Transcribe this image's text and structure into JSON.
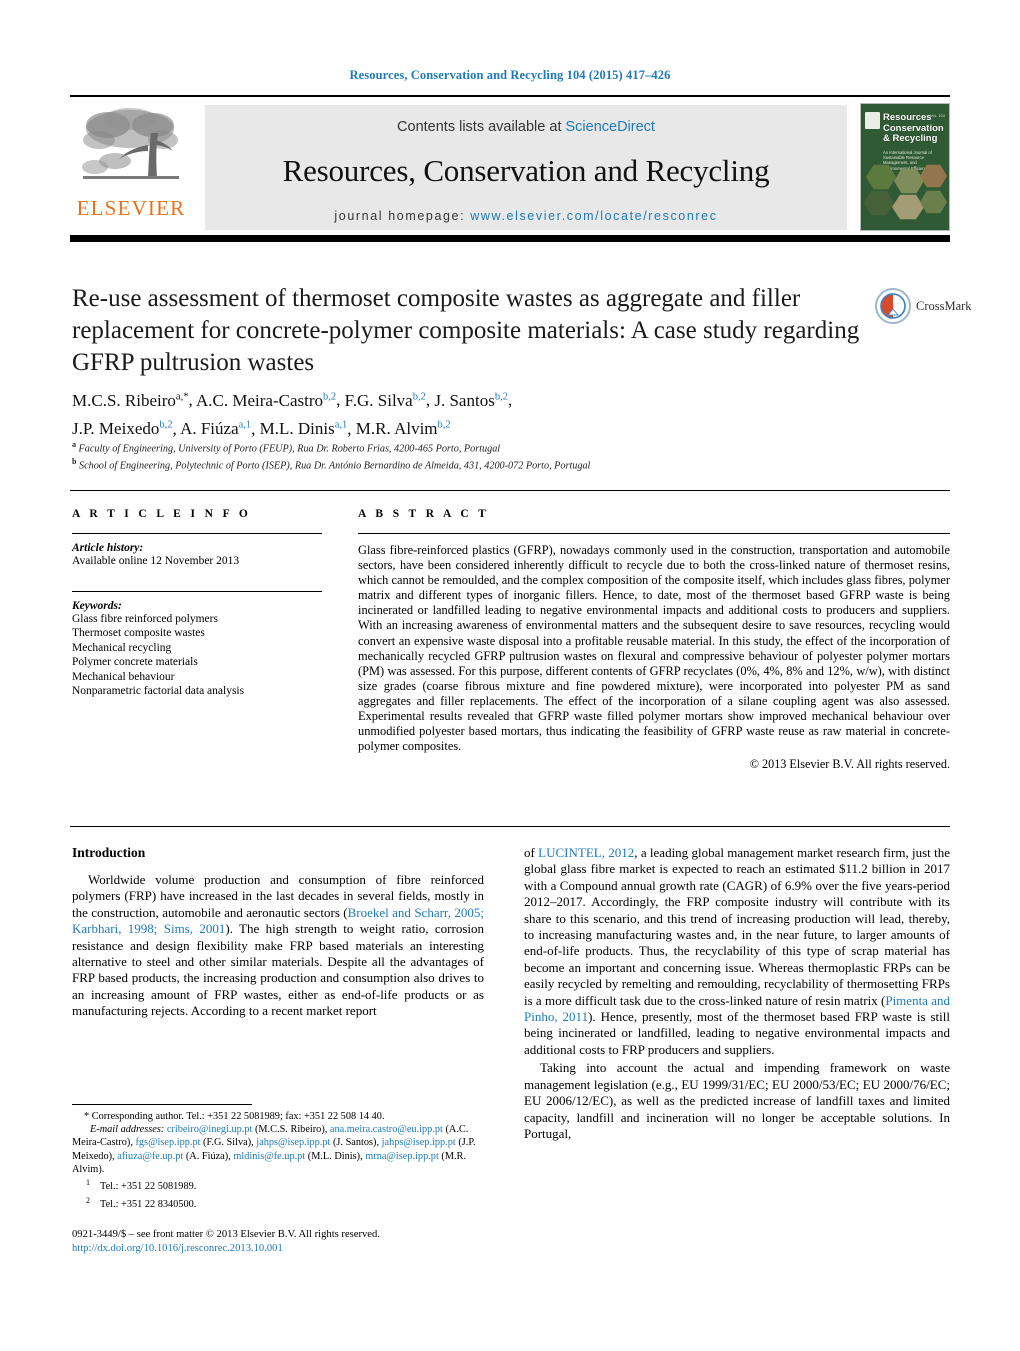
{
  "running_head": "Resources, Conservation and Recycling 104 (2015) 417–426",
  "masthead": {
    "publisher_name": "ELSEVIER",
    "contents_prefix": "Contents lists available at ",
    "contents_link": "ScienceDirect",
    "journal_name": "Resources, Conservation and Recycling",
    "homepage_label": "journal homepage:",
    "homepage_url": "www.elsevier.com/locate/resconrec",
    "cover_title": "Resources Conservation & Recycling",
    "cover_subtitle": "An International Journal of Sustainable Resource Management, and Environmental Efficiency",
    "cover_volume": "Vol. 104"
  },
  "article": {
    "title": "Re-use assessment of thermoset composite wastes as aggregate and filler replacement for concrete-polymer composite materials: A case study regarding GFRP pultrusion wastes",
    "crossmark_label": "CrossMark",
    "authors_line1": "M.C.S. Ribeiro",
    "authors_html_line1_sup": "a,*",
    "authors": [
      {
        "name": "M.C.S. Ribeiro",
        "sup": "a,*"
      },
      {
        "name": "A.C. Meira-Castro",
        "sup": "b,2"
      },
      {
        "name": "F.G. Silva",
        "sup": "b,2"
      },
      {
        "name": "J. Santos",
        "sup": "b,2"
      },
      {
        "name": "J.P. Meixedo",
        "sup": "b,2"
      },
      {
        "name": "A. Fiúza",
        "sup": "a,1"
      },
      {
        "name": "M.L. Dinis",
        "sup": "a,1"
      },
      {
        "name": "M.R. Alvim",
        "sup": "b,2"
      }
    ],
    "affiliations": [
      {
        "mark": "a",
        "text": "Faculty of Engineering, University of Porto (FEUP), Rua Dr. Roberto Frias, 4200-465 Porto, Portugal"
      },
      {
        "mark": "b",
        "text": "School of Engineering, Polytechnic of Porto (ISEP), Rua Dr. António Bernardino de Almeida, 431, 4200-072 Porto, Portugal"
      }
    ]
  },
  "article_info": {
    "heading": "A R T I C L E   I N F O",
    "history_label": "Article history:",
    "history_value": "Available online 12 November 2013",
    "keywords_label": "Keywords:",
    "keywords": [
      "Glass fibre reinforced polymers",
      "Thermoset composite wastes",
      "Mechanical recycling",
      "Polymer concrete materials",
      "Mechanical behaviour",
      "Nonparametric factorial data analysis"
    ]
  },
  "abstract": {
    "heading": "A B S T R A C T",
    "text": "Glass fibre-reinforced plastics (GFRP), nowadays commonly used in the construction, transportation and automobile sectors, have been considered inherently difficult to recycle due to both the cross-linked nature of thermoset resins, which cannot be remoulded, and the complex composition of the composite itself, which includes glass fibres, polymer matrix and different types of inorganic fillers. Hence, to date, most of the thermoset based GFRP waste is being incinerated or landfilled leading to negative environmental impacts and additional costs to producers and suppliers. With an increasing awareness of environmental matters and the subsequent desire to save resources, recycling would convert an expensive waste disposal into a profitable reusable material. In this study, the effect of the incorporation of mechanically recycled GFRP pultrusion wastes on flexural and compressive behaviour of polyester polymer mortars (PM) was assessed. For this purpose, different contents of GFRP recyclates (0%, 4%, 8% and 12%, w/w), with distinct size grades (coarse fibrous mixture and fine powdered mixture), were incorporated into polyester PM as sand aggregates and filler replacements. The effect of the incorporation of a silane coupling agent was also assessed. Experimental results revealed that GFRP waste filled polymer mortars show improved mechanical behaviour over unmodified polyester based mortars, thus indicating the feasibility of GFRP waste reuse as raw material in concrete-polymer composites.",
    "copyright": "© 2013 Elsevier B.V. All rights reserved."
  },
  "body": {
    "intro_heading": "Introduction",
    "left_para_1_a": "Worldwide volume production and consumption of fibre reinforced polymers (FRP) have increased in the last decades in several fields, mostly in the construction, automobile and aeronautic sectors (",
    "left_para_1_cite": "Broekel and Scharr, 2005; Karbhari, 1998; Sims, 2001",
    "left_para_1_b": "). The high strength to weight ratio, corrosion resistance and design flexibility make FRP based materials an interesting alternative to steel and other similar materials. Despite all the advantages of FRP based products, the increasing production and consumption also drives to an increasing amount of FRP wastes, either as end-of-life products or as manufacturing rejects. According to a recent market report",
    "right_para_1_a": "of ",
    "right_para_1_cite": "LUCINTEL, 2012",
    "right_para_1_b": ", a leading global management market research firm, just the global glass fibre market is expected to reach an estimated $11.2 billion in 2017 with a Compound annual growth rate (CAGR) of 6.9% over the five years-period 2012–2017. Accordingly, the FRP composite industry will contribute with its share to this scenario, and this trend of increasing production will lead, thereby, to increasing manufacturing wastes and, in the near future, to larger amounts of end-of-life products. Thus, the recyclability of this type of scrap material has become an important and concerning issue. Whereas thermoplastic FRPs can be easily recycled by remelting and remoulding, recyclability of thermosetting FRPs is a more difficult task due to the cross-linked nature of resin matrix (",
    "right_para_1_cite2": "Pimenta and Pinho, 2011",
    "right_para_1_c": "). Hence, presently, most of the thermoset based FRP waste is still being incinerated or landfilled, leading to negative environmental impacts and additional costs to FRP producers and suppliers.",
    "right_para_2": "Taking into account the actual and impending framework on waste management legislation (e.g., EU 1999/31/EC; EU 2000/53/EC; EU 2000/76/EC; EU 2006/12/EC), as well as the predicted increase of landfill taxes and limited capacity, landfill and incineration will no longer be acceptable solutions. In Portugal,"
  },
  "footnotes": {
    "corresponding": "Corresponding author. Tel.: +351 22 5081989; fax: +351 22 508 14 40.",
    "email_label": "E-mail addresses:",
    "emails": [
      {
        "address": "cribeiro@inegi.up.pt",
        "owner": "(M.C.S. Ribeiro),"
      },
      {
        "address": "ana.meira.castro@eu.ipp.pt",
        "owner": "(A.C. Meira-Castro),"
      },
      {
        "address": "fgs@isep.ipp.pt",
        "owner": "(F.G. Silva),"
      },
      {
        "address": "jahps@isep.ipp.pt",
        "owner": "(J. Santos),"
      },
      {
        "address": "jahps@isep.ipp.pt",
        "owner": "(J.P. Meixedo),"
      },
      {
        "address": "afiuza@fe.up.pt",
        "owner": "(A. Fiúza),"
      },
      {
        "address": "mldinis@fe.up.pt",
        "owner": "(M.L. Dinis),"
      },
      {
        "address": "mrna@isep.ipp.pt",
        "owner": "(M.R. Alvim)."
      }
    ],
    "tel1_mark": "1",
    "tel1": "Tel.: +351 22 5081989.",
    "tel2_mark": "2",
    "tel2": "Tel.: +351 22 8340500."
  },
  "imprint": {
    "issn_line": "0921-3449/$ – see front matter © 2013 Elsevier B.V. All rights reserved.",
    "doi": "http://dx.doi.org/10.1016/j.resconrec.2013.10.001"
  },
  "colors": {
    "link_blue": "#1f7ab5",
    "elsevier_orange": "#E9711C",
    "band_grey": "#e8e8e8",
    "cover_green": "#2f5a33"
  }
}
